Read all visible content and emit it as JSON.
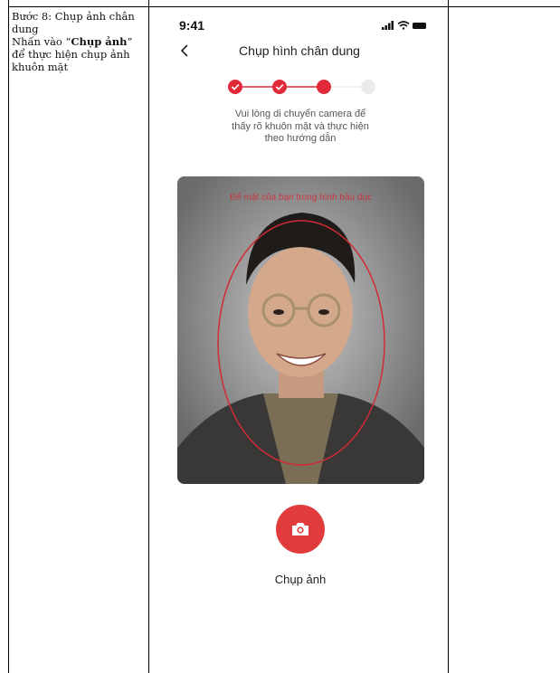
{
  "instructions": {
    "line1": "Bước 8: Chụp ảnh chân dung",
    "line2_prefix": "Nhấn vào “",
    "line2_bold": "Chụp ảnh",
    "line2_suffix": "”",
    "line3": "để thực hiện chụp ảnh khuôn mặt"
  },
  "status_bar": {
    "time": "9:41",
    "icons": [
      "signal-icon",
      "wifi-icon",
      "battery-icon"
    ]
  },
  "header": {
    "title": "Chụp hình chân dung",
    "back_icon": "chevron-left-icon"
  },
  "stepper": {
    "steps": [
      "completed",
      "completed",
      "current",
      "pending"
    ],
    "accent_color": "#e02a3a",
    "pending_color": "#e6e6e6"
  },
  "description": {
    "line1": "Vui lòng di chuyển camera để",
    "line2": "thấy rõ khuôn mặt và thực hiện",
    "line3": "theo hướng dẫn"
  },
  "camera": {
    "hint": "Để mặt của bạn trong hình bầu dục",
    "oval_color": "#d12b35"
  },
  "capture": {
    "label": "Chụp ảnh",
    "icon": "camera-icon",
    "color": "#e13c3c"
  }
}
